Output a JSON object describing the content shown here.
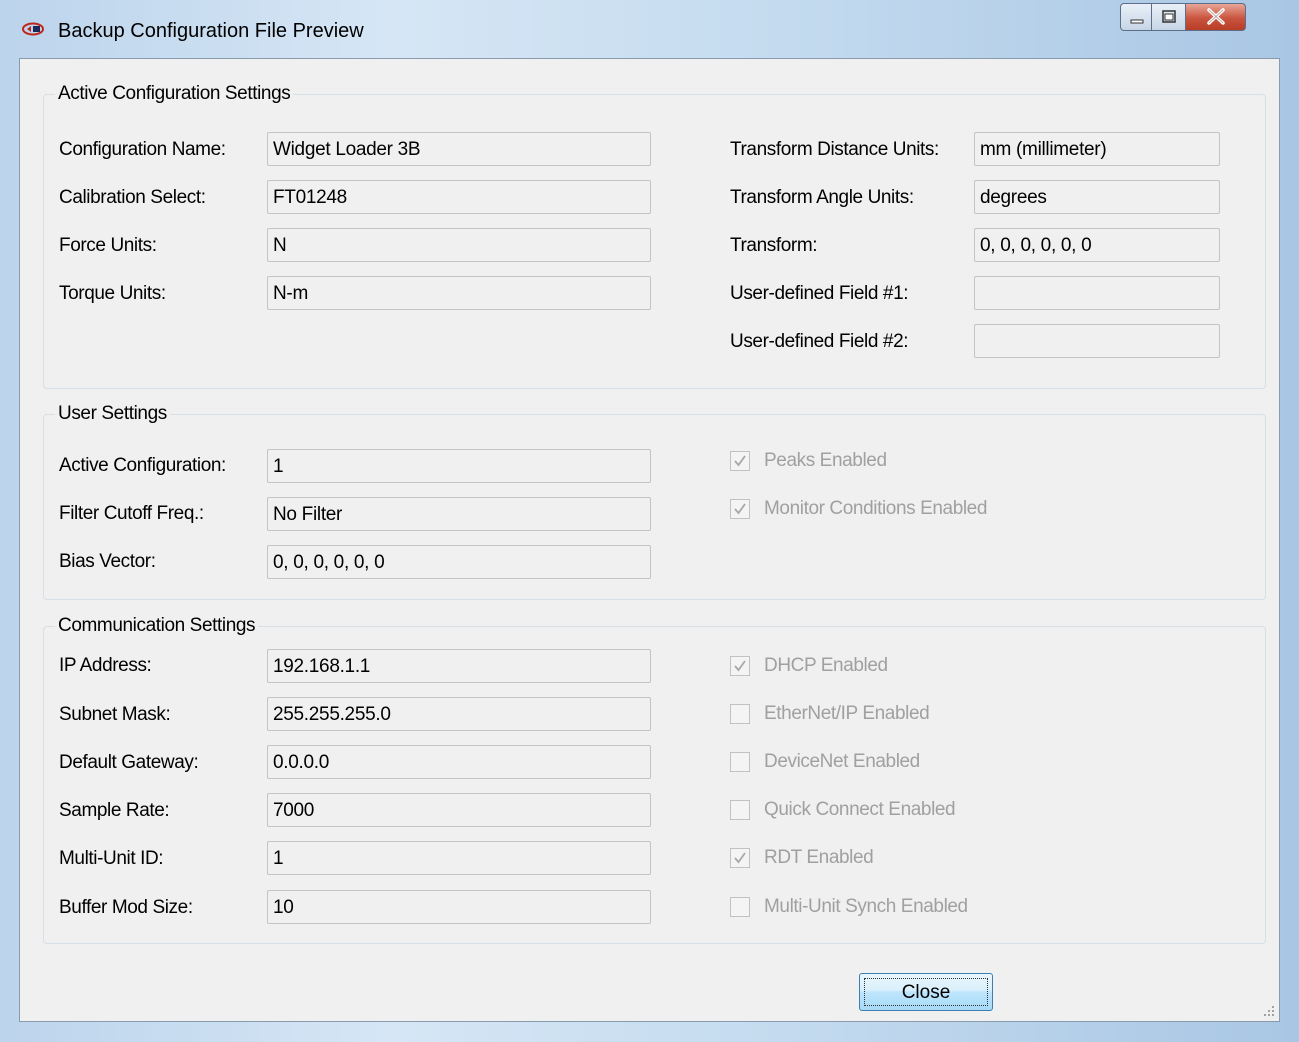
{
  "window": {
    "title": "Backup Configuration File Preview"
  },
  "active_config": {
    "group_label": "Active Configuration Settings",
    "configuration_name": {
      "label": "Configuration Name:",
      "value": "Widget Loader 3B"
    },
    "calibration_select": {
      "label": "Calibration Select:",
      "value": "FT01248"
    },
    "force_units": {
      "label": "Force Units:",
      "value": "N"
    },
    "torque_units": {
      "label": "Torque Units:",
      "value": "N-m"
    },
    "transform_distance_units": {
      "label": "Transform Distance Units:",
      "value": "mm (millimeter)"
    },
    "transform_angle_units": {
      "label": "Transform Angle Units:",
      "value": "degrees"
    },
    "transform": {
      "label": "Transform:",
      "value": "0, 0, 0, 0, 0, 0"
    },
    "user_field_1": {
      "label": "User-defined Field #1:",
      "value": ""
    },
    "user_field_2": {
      "label": "User-defined Field #2:",
      "value": ""
    }
  },
  "user_settings": {
    "group_label": "User Settings",
    "active_configuration": {
      "label": "Active Configuration:",
      "value": "1"
    },
    "filter_cutoff": {
      "label": "Filter Cutoff Freq.:",
      "value": "No Filter"
    },
    "bias_vector": {
      "label": "Bias Vector:",
      "value": "0, 0, 0, 0, 0, 0"
    },
    "peaks_enabled": {
      "label": "Peaks Enabled",
      "checked": true
    },
    "monitor_conditions_enabled": {
      "label": "Monitor Conditions Enabled",
      "checked": true
    }
  },
  "communication": {
    "group_label": "Communication Settings",
    "ip_address": {
      "label": "IP Address:",
      "value": "192.168.1.1"
    },
    "subnet_mask": {
      "label": "Subnet Mask:",
      "value": "255.255.255.0"
    },
    "default_gateway": {
      "label": "Default Gateway:",
      "value": "0.0.0.0"
    },
    "sample_rate": {
      "label": "Sample Rate:",
      "value": "7000"
    },
    "multi_unit_id": {
      "label": "Multi-Unit ID:",
      "value": "1"
    },
    "buffer_mod_size": {
      "label": "Buffer Mod Size:",
      "value": "10"
    },
    "dhcp_enabled": {
      "label": "DHCP Enabled",
      "checked": true
    },
    "ethernet_ip_enabled": {
      "label": "EtherNet/IP Enabled",
      "checked": false
    },
    "devicenet_enabled": {
      "label": "DeviceNet Enabled",
      "checked": false
    },
    "quick_connect_enabled": {
      "label": "Quick Connect Enabled",
      "checked": false
    },
    "rdt_enabled": {
      "label": "RDT Enabled",
      "checked": true
    },
    "multi_unit_synch_enabled": {
      "label": "Multi-Unit Synch Enabled",
      "checked": false
    }
  },
  "buttons": {
    "close_label": "Close"
  },
  "colors": {
    "disabled_text": "#a0a0a0",
    "field_background": "#f0f0f0",
    "close_button_red": "#c9543f"
  }
}
